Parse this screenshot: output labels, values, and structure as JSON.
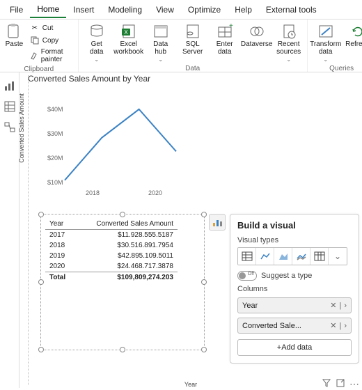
{
  "menu": {
    "tabs": [
      "File",
      "Home",
      "Insert",
      "Modeling",
      "View",
      "Optimize",
      "Help",
      "External tools"
    ],
    "active": 1
  },
  "ribbon": {
    "clipboard": {
      "paste": "Paste",
      "cut": "Cut",
      "copy": "Copy",
      "format": "Format painter",
      "group": "Clipboard"
    },
    "data": {
      "get": "Get\ndata",
      "excel": "Excel\nworkbook",
      "hub": "Data\nhub",
      "sql": "SQL\nServer",
      "enter": "Enter\ndata",
      "dataverse": "Dataverse",
      "recent": "Recent\nsources",
      "group": "Data"
    },
    "queries": {
      "transform": "Transform\ndata",
      "refresh": "Refresh",
      "group": "Queries"
    }
  },
  "chart_data": {
    "type": "line",
    "title": "Converted Sales Amount by Year",
    "xlabel": "Year",
    "ylabel": "Converted Sales Amount",
    "x": [
      2017,
      2018,
      2019,
      2020
    ],
    "xticks": [
      "2018",
      "2020"
    ],
    "yticks": [
      "$10M",
      "$20M",
      "$30M",
      "$40M"
    ],
    "values": [
      11.9,
      30.5,
      42.9,
      24.5
    ],
    "ylim": [
      10,
      45
    ]
  },
  "table": {
    "headers": [
      "Year",
      "Converted Sales Amount"
    ],
    "rows": [
      [
        "2017",
        "$11.928.555.5187"
      ],
      [
        "2018",
        "$30.516.891.7954"
      ],
      [
        "2019",
        "$42.895.109.5011"
      ],
      [
        "2020",
        "$24.468.717.3878"
      ]
    ],
    "total": [
      "Total",
      "$109,809,274.203"
    ]
  },
  "panel": {
    "title": "Build a visual",
    "vtypes_label": "Visual types",
    "suggest": "Suggest a type",
    "toggle_state": "Off",
    "columns_label": "Columns",
    "fields": [
      "Year",
      "Converted Sale..."
    ],
    "add": "+Add data"
  }
}
